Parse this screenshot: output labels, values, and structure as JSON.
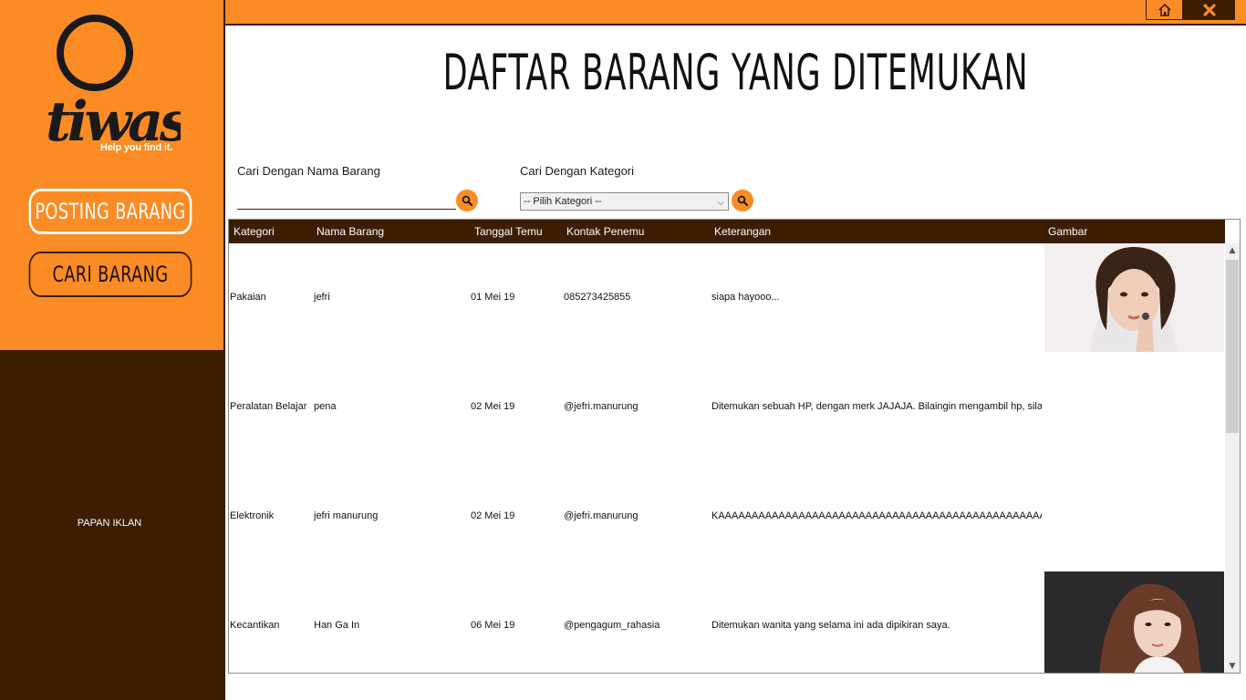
{
  "sidebar": {
    "tagline": "Help you find it.",
    "nav": [
      {
        "label": "POSTING BARANG"
      },
      {
        "label": "CARI BARANG"
      }
    ],
    "ad_label": "PAPAN IKLAN"
  },
  "colors": {
    "accent": "#fb8c25",
    "dark": "#3c1d00"
  },
  "header": {
    "title": "DAFTAR BARANG YANG DITEMUKAN"
  },
  "window_controls": {
    "home_icon": "home-icon",
    "close_icon": "close-icon"
  },
  "search": {
    "name_label": "Cari Dengan Nama Barang",
    "name_value": "",
    "category_label": "Cari Dengan Kategori",
    "category_selected": "-- Pilih Kategori --"
  },
  "table": {
    "columns": [
      "Kategori",
      "Nama Barang",
      "Tanggal Temu",
      "Kontak Penemu",
      "Keterangan",
      "Gambar"
    ],
    "rows": [
      {
        "kategori": "Pakaian",
        "nama": "jefri",
        "tanggal": "01 Mei 19",
        "kontak": "085273425855",
        "keterangan": "siapa hayooo...",
        "gambar": "photo"
      },
      {
        "kategori": "Peralatan Belajar",
        "nama": "pena",
        "tanggal": "02 Mei 19",
        "kontak": "@jefri.manurung",
        "keterangan": "Ditemukan sebuah HP, dengan merk JAJAJA. Bilaingin mengambil hp, sila...",
        "gambar": ""
      },
      {
        "kategori": "Elektronik",
        "nama": "jefri manurung",
        "tanggal": "02 Mei 19",
        "kontak": "@jefri.manurung",
        "keterangan": "KAAAAAAAAAAAAAAAAAAAAAAAAAAAAAAAAAAAAAAAAAAAAAAAAAAAAAAAA...",
        "gambar": ""
      },
      {
        "kategori": "Kecantikan",
        "nama": "Han Ga In",
        "tanggal": "06 Mei 19",
        "kontak": "@pengagum_rahasia",
        "keterangan": "Ditemukan wanita yang selama ini ada dipikiran saya.",
        "gambar": "photo"
      }
    ]
  }
}
